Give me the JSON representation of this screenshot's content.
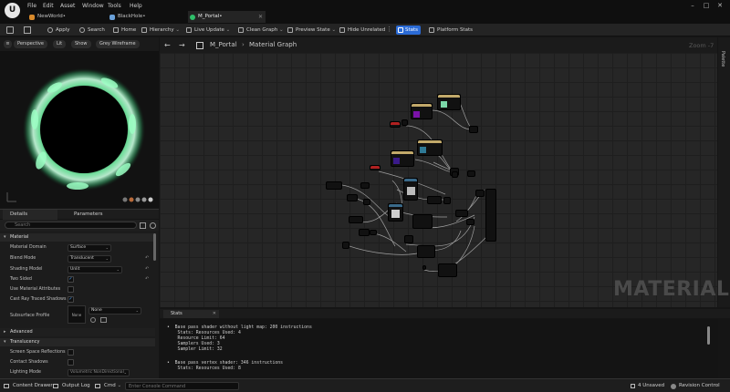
{
  "titlebar": {
    "menu": [
      "File",
      "Edit",
      "Asset",
      "Window",
      "Tools",
      "Help"
    ],
    "tabs": [
      {
        "label": "NewWorld•",
        "color": "#d98a2b"
      },
      {
        "label": "BlackHole•",
        "color": "#6aa0d8"
      },
      {
        "label": "M_Portal•",
        "color": "#2fbf6a"
      }
    ],
    "window_buttons": [
      "–",
      "□",
      "✕"
    ]
  },
  "toolbar": {
    "apply": "Apply",
    "search": "Search",
    "home": "Home",
    "hierarchy": "Hierarchy",
    "live_update": "Live Update",
    "clean_graph": "Clean Graph",
    "preview_state": "Preview State",
    "hide_unrelated": "Hide Unrelated",
    "stats": "Stats",
    "platform_stats": "Platform Stats"
  },
  "viewport": {
    "perspective": "Perspective",
    "lit": "Lit",
    "show": "Show",
    "wireframe": "Grey Wireframe"
  },
  "details": {
    "tab_details": "Details",
    "tab_parameters": "Parameters",
    "search_placeholder": "Search",
    "section_material": "Material",
    "props": {
      "material_domain": {
        "label": "Material Domain",
        "value": "Surface"
      },
      "blend_mode": {
        "label": "Blend Mode",
        "value": "Translucent"
      },
      "shading_model": {
        "label": "Shading Model",
        "value": "Unlit"
      },
      "two_sided": {
        "label": "Two Sided"
      },
      "use_material_attributes": {
        "label": "Use Material Attributes"
      },
      "cast_ray_traced_shadows": {
        "label": "Cast Ray Traced Shadows"
      },
      "subsurface_profile": {
        "label": "Subsurface Profile",
        "thumb": "None",
        "value": "None"
      }
    },
    "section_advanced": "Advanced",
    "section_translucency": "Translucency",
    "translucency_props": {
      "ssr": "Screen Space Reflections",
      "contact_shadows": "Contact Shadows",
      "lighting_mode": {
        "label": "Lighting Mode",
        "value": "Volumetric NonDirectional"
      }
    }
  },
  "graph": {
    "breadcrumb_asset": "M_Portal",
    "breadcrumb_graph": "Material Graph",
    "zoom": "Zoom -7",
    "watermark": "MATERIAL",
    "palette": "Palette"
  },
  "stats": {
    "tab_label": "Stats",
    "lines": [
      "•  Base pass shader without light map: 200 instructions",
      "    Stats: Resources Used: 4",
      "    Resource Limit: 64",
      "    Samplers Used: 3",
      "    Sampler Limit: 32",
      "",
      "•  Base pass vertex shader: 346 instructions",
      "    Stats: Resources Used: 8"
    ]
  },
  "bottombar": {
    "content_drawer": "Content Drawer",
    "output_log": "Output Log",
    "cmd": "Cmd",
    "console_placeholder": "Enter Console Command",
    "unsaved": "4 Unsaved",
    "revision_control": "Revision Control"
  }
}
